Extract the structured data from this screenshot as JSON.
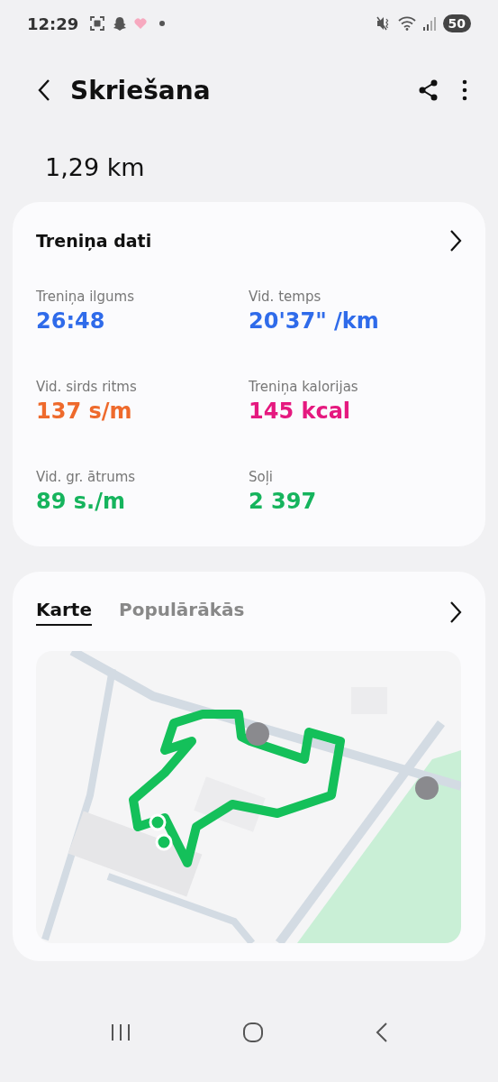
{
  "status_bar": {
    "time": "12:29",
    "battery": "50"
  },
  "header": {
    "title": "Skriešana"
  },
  "distance": "1,29 km",
  "workout_card": {
    "title": "Treniņa dati",
    "stats": [
      {
        "label": "Treniņa ilgums",
        "value": "26:48",
        "color": "#2f6bea"
      },
      {
        "label": "Vid. temps",
        "value": "20'37\" /km",
        "color": "#2f6bea"
      },
      {
        "label": "Vid. sirds ritms",
        "value": "137 s/m",
        "color": "#ee6a2c"
      },
      {
        "label": "Treniņa kalorijas",
        "value": "145 kcal",
        "color": "#e5197f"
      },
      {
        "label": "Vid. gr. ātrums",
        "value": "89 s./m",
        "color": "#16b45d"
      },
      {
        "label": "Soļi",
        "value": "2 397",
        "color": "#16b45d"
      }
    ]
  },
  "map_card": {
    "tabs": [
      {
        "label": "Karte",
        "selected": true
      },
      {
        "label": "Populārākās",
        "selected": false
      }
    ]
  }
}
